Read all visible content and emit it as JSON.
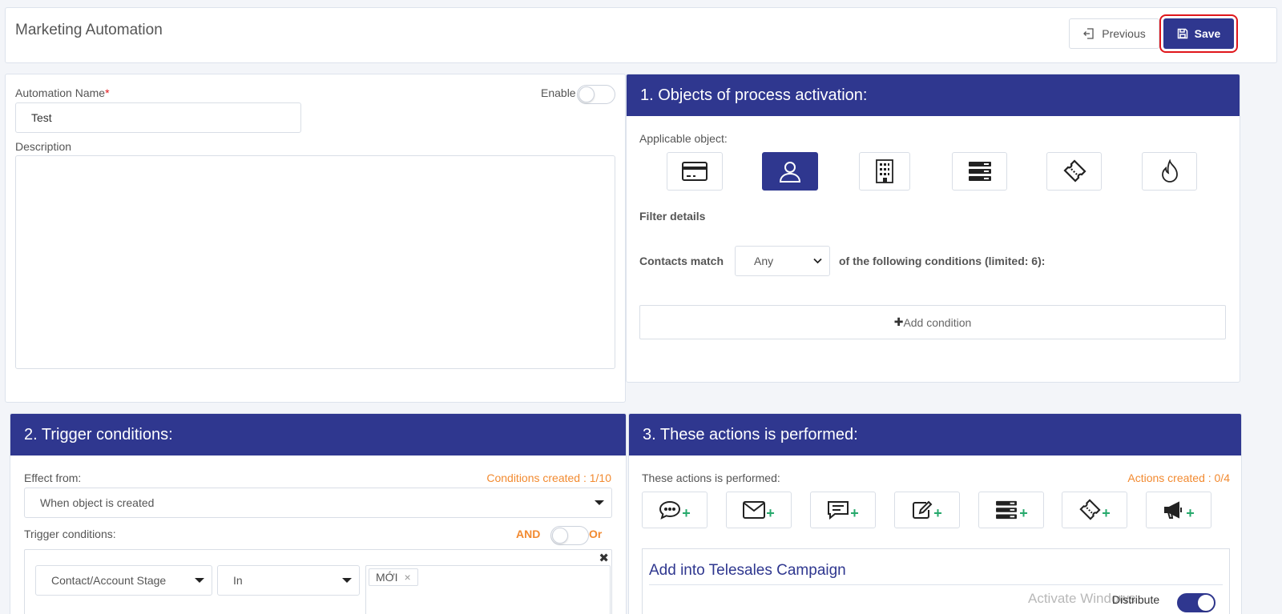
{
  "header": {
    "title": "Marketing Automation",
    "previous_label": "Previous",
    "save_label": "Save"
  },
  "form": {
    "name_label": "Automation Name",
    "required_mark": "*",
    "name_value": "Test",
    "enable_label": "Enable",
    "enabled": false,
    "description_label": "Description"
  },
  "objects": {
    "title": "1. Objects of process activation:",
    "applicable_label": "Applicable object:",
    "icons": [
      "card-icon",
      "contact-icon",
      "building-icon",
      "list-icon",
      "ticket-icon",
      "fire-icon"
    ],
    "active_index": 1,
    "filter_label": "Filter details",
    "contacts_match_label": "Contacts match",
    "match_value": "Any",
    "conditions_suffix": "of the following conditions (limited: 6):",
    "add_condition_label": "Add condition"
  },
  "triggers": {
    "title": "2. Trigger conditions:",
    "effect_label": "Effect from:",
    "conditions_created": "Conditions created : 1/10",
    "effect_value": "When object is created",
    "trigger_label": "Trigger conditions:",
    "and_label": "AND",
    "or_label": "Or",
    "field_value": "Contact/Account Stage",
    "operator_value": "In",
    "tag_value": "MỚI"
  },
  "actions": {
    "title": "3. These actions is performed:",
    "performed_label": "These actions is performed:",
    "actions_created": "Actions created : 0/4",
    "icons": [
      "chat-add-icon",
      "mail-add-icon",
      "message-add-icon",
      "edit-add-icon",
      "list-add-icon",
      "ticket-add-icon",
      "megaphone-add-icon"
    ],
    "telesales_title": "Add into Telesales Campaign",
    "distribute_label": "Distribute",
    "watermark": "Activate Windows"
  },
  "colors": {
    "primary": "#2f378f",
    "accent_orange": "#f28a30",
    "plus_green": "#26a96c",
    "highlight_red": "#e0161b"
  }
}
